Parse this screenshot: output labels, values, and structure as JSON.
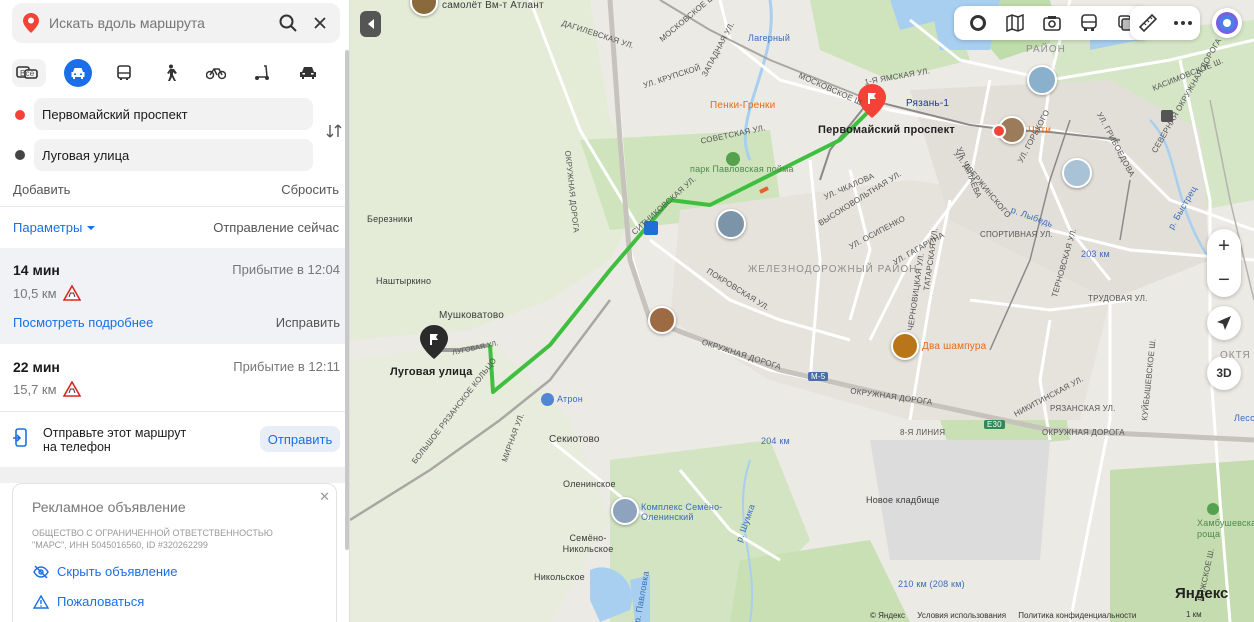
{
  "search": {
    "placeholder": "Искать вдоль маршрута"
  },
  "modes": {
    "all_label": "Все"
  },
  "route": {
    "from": "Первомайский проспект",
    "to": "Луговая улица",
    "add_label": "Добавить",
    "reset_label": "Сбросить"
  },
  "params": {
    "label": "Параметры",
    "departure": "Отправление сейчас"
  },
  "routes": [
    {
      "time": "14 мин",
      "arrival": "Прибытие в 12:04",
      "distance": "10,5 км",
      "details": "Посмотреть подробнее",
      "edit": "Исправить"
    },
    {
      "time": "22 мин",
      "arrival": "Прибытие в 12:11",
      "distance": "15,7 км"
    }
  ],
  "send": {
    "text": "Отправьте этот маршрут на телефон",
    "button": "Отправить"
  },
  "ad": {
    "title": "Рекламное объявление",
    "org": "ОБЩЕСТВО С ОГРАНИЧЕННОЙ ОТВЕТСТВЕННОСТЬЮ \"МАРС\", ИНН 5045016560, ID #320262299",
    "hide": "Скрыть объявление",
    "report": "Пожаловаться"
  },
  "map": {
    "labels": {
      "start_title": "Первомайский проспект",
      "end_title": "Луговая улица",
      "lagerny": "Лагерный",
      "ryazan1": "Рязань-1",
      "penki": "Пенки-Гренки",
      "chity": "Чити",
      "park": "парк Павловская пойма",
      "railway_district": "ЖЕЛЕЗНОДОРОЖНЫЙ РАЙОН",
      "raion_top": "РАЙОН",
      "oktyabrsky": "ОКТЯ",
      "bereznik": "Березники",
      "nashatyrkino": "Наштыркино",
      "mushkovatovo": "Мушковатово",
      "atron": "Атрон",
      "sekiotovo": "Секиотово",
      "oleninskoe": "Оленинское",
      "semeno": "Семёно-Никольское",
      "nikolskoe": "Никольское",
      "complex": "Комплекс Семёно-Оленинский",
      "dva_shampura": "Два шампура",
      "novoe_kladbishe": "Новое кладбище",
      "hambush": "Хамбушевская роща",
      "km204": "204 км",
      "km203": "203 км",
      "km210": "210 км (208 км)",
      "m5": "М-5",
      "e30": "Е30",
      "lesok": "Лесок",
      "samolet": "самолёт Вм-т Атлант",
      "okruzhnaya": "ОКРУЖНАЯ ДОРОГА",
      "okruzhnaya_v": "ОКРУЖНАЯ ДОРОГА",
      "bolshoe": "БОЛЬШОЕ РЯЗАНСКОЕ КОЛЬЦО",
      "sitnikovskaya": "СИТНИКОВСКАЯ УЛ.",
      "pokrovskaya": "ПОКРОВСКАЯ УЛ.",
      "moskovskoe": "МОСКОВСКОЕ Ш.",
      "moskovskoe2": "МОСКОВСКОЕ ШОССЕ",
      "dzerzhinskogo": "УЛ. ДЗЕРЖИНСКОГО",
      "sportivnaya": "СПОРТИВНАЯ УЛ.",
      "kasimovskoe": "КАСИМОВСКОЕ Ш.",
      "griboedova": "УЛ. ГРИБОЕДОВА",
      "sovetskaya": "СОВЕТСКАЯ УЛ.",
      "krupskoy": "УЛ. КРУПСКОЙ",
      "lugovaya_small": "ЛУГОВАЯ УЛ.",
      "mirnaya": "МИРНАЯ УЛ.",
      "trudovaya": "ТРУДОВАЯ УЛ.",
      "ryazanskaya": "РЯЗАНСКАЯ УЛ.",
      "line8": "8-Я ЛИНИЯ",
      "kuibyshevskoe": "КУЙБЫШЕВСКОЕ Ш.",
      "ryazhskoe": "РЯЖСКОЕ Ш.",
      "severnaya": "СЕВЕРНАЯ ОКРУЖНАЯ ДОРОГА",
      "dagilevskaya": "ДАГИЛЕВСКАЯ УЛ.",
      "shumka": "р. Шумка",
      "pavlovka": "р. Павловка",
      "bystrets": "р. Быстрец",
      "lybed": "р. Лыбедь",
      "chapaeva": "УЛ. ЧАПАЕВА",
      "gagarina": "УЛ. ГАГАРИНА",
      "gorkogo": "УЛ. ГОРЬКОГО",
      "osipenko": "УЛ. ОСИПЕНКО",
      "chernovitskaya": "ЧЕРНОВИЦКАЯ УЛ.",
      "tatarskaya": "ТАТАРСКАЯ УЛ.",
      "vysokovoltnaya": "ВЫСОКОВОЛЬТНАЯ УЛ.",
      "chkalova": "УЛ. ЧКАЛОВА",
      "zapadnaya": "ЗАПАДНАЯ УЛ.",
      "ternovskaya": "ТЕРНОВСКАЯ УЛ.",
      "nikitinskaya": "НИКИТИНСКАЯ УЛ.",
      "yamskaya": "1-Я ЯМСКАЯ УЛ."
    },
    "footer": {
      "copyright": "© Яндекс",
      "terms": "Условия использования",
      "privacy": "Политика конфиденциальности"
    },
    "logo": "Яндекс",
    "scale": "1 км",
    "btn3d": "3D",
    "zoom_in": "+",
    "zoom_out": "−"
  },
  "colors": {
    "accent": "#1a6fe8",
    "route": "#3fbf3f",
    "start_pin": "#f44336",
    "brand_red": "#fc3f1d"
  }
}
